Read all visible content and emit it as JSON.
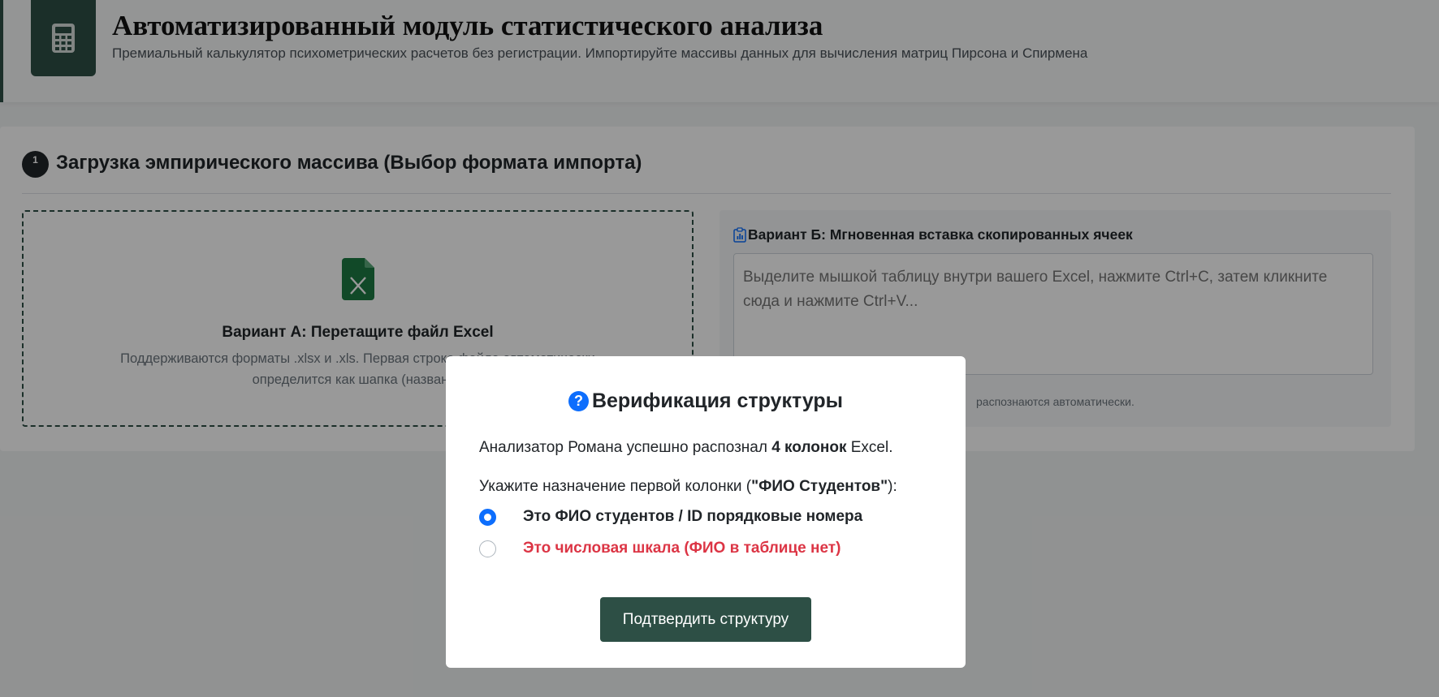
{
  "header": {
    "title": "Автоматизированный модуль статистического анализа",
    "subtitle": "Премиальный калькулятор психометрических расчетов без регистрации. Импортируйте массивы данных для вычисления матриц Пирсона и Спирмена",
    "logo_icon": "calculator-icon"
  },
  "step": {
    "number": "1",
    "title": "Загрузка эмпирического массива (Выбор формата импорта)"
  },
  "option_a": {
    "icon": "excel-file-icon",
    "title": "Вариант А: Перетащите файл Excel",
    "desc_line1": "Поддерживаются форматы .xlsx и .xls. Первая строка файла автоматически",
    "desc_line2": "определится как шапка (названия"
  },
  "option_b": {
    "icon": "clipboard-icon",
    "title": "Вариант Б: Мгновенная вставка скопированных ячеек",
    "placeholder": "Выделите мышкой таблицу внутри вашего Excel, нажмите Ctrl+C, затем кликните сюда и нажмите Ctrl+V...",
    "hint": "распознаются автоматически."
  },
  "modal": {
    "icon": "question-icon",
    "icon_glyph": "?",
    "title": "Верификация структуры",
    "line1_pre": "Анализатор Романа успешно распознал ",
    "line1_bold": "4 колонок",
    "line1_post": " Excel.",
    "line2_pre": "Укажите назначение первой колонки (",
    "line2_bold": "\"ФИО Студентов\"",
    "line2_post": "):",
    "options": [
      {
        "label": "Это ФИО студентов / ID порядковые номера",
        "checked": true,
        "color": "#212529"
      },
      {
        "label": "Это числовая шкала (ФИО в таблице нет)",
        "checked": false,
        "color": "#dc3545"
      }
    ],
    "confirm_label": "Подтвердить структуру"
  },
  "colors": {
    "brand": "#2d4f45",
    "accent": "#0d6efd",
    "danger": "#dc3545"
  }
}
